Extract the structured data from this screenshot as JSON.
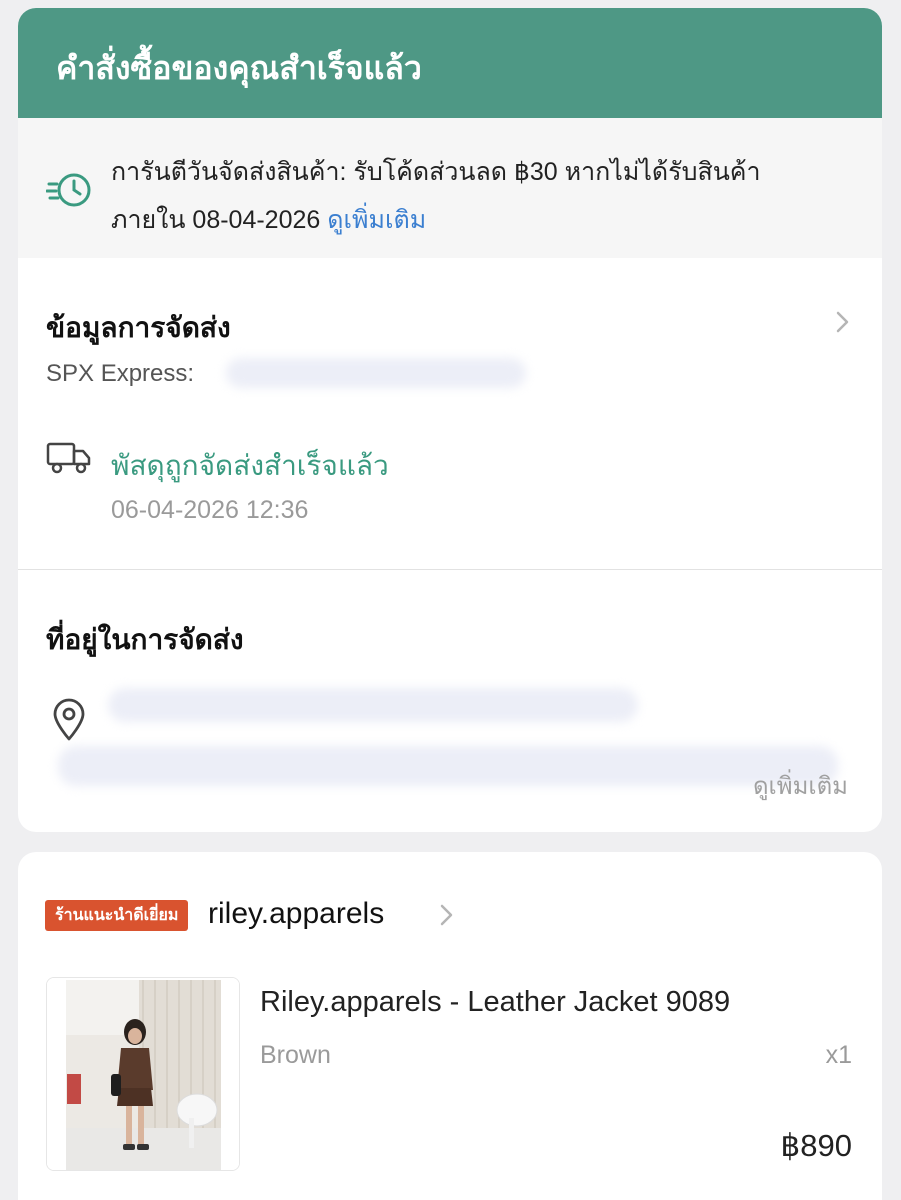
{
  "banner": {
    "title": "คำสั่งซื้อของคุณสำเร็จแล้ว"
  },
  "guarantee": {
    "text": "การันตีวันจัดส่งสินค้า: รับโค้ดส่วนลด ฿30 หากไม่ได้รับสินค้าภายใน 08-04-2026",
    "link_label": "ดูเพิ่มเติม"
  },
  "shipping": {
    "title": "ข้อมูลการจัดส่ง",
    "carrier": "SPX Express:",
    "status": "พัสดุถูกจัดส่งสำเร็จแล้ว",
    "status_time": "06-04-2026 12:36"
  },
  "address": {
    "title": "ที่อยู่ในการจัดส่ง",
    "more_label": "ดูเพิ่มเติม"
  },
  "shop": {
    "badge": "ร้านแนะนำดีเยี่ยม",
    "name": "riley.apparels"
  },
  "product": {
    "name": "Riley.apparels - Leather Jacket 9089",
    "variant": "Brown",
    "quantity": "x1",
    "price": "฿890"
  },
  "colors": {
    "banner": "#4e9885",
    "status": "#3a9a80",
    "link": "#3b7fd0",
    "badge": "#d9532f"
  }
}
